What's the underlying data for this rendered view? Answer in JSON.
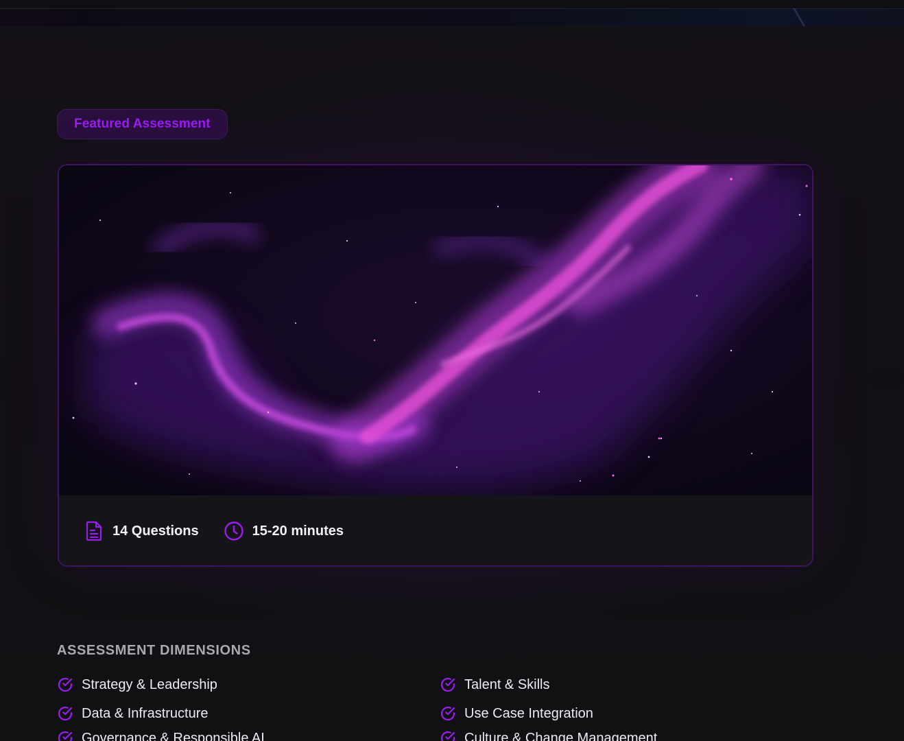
{
  "badge": {
    "label": "Featured Assessment"
  },
  "card": {
    "image_alt": "purple nebula",
    "stats": [
      {
        "icon": "document-icon",
        "label": "14 Questions"
      },
      {
        "icon": "clock-icon",
        "label": "15-20 minutes"
      }
    ]
  },
  "dimensions": {
    "title": "ASSESSMENT DIMENSIONS",
    "items": [
      {
        "label": "Strategy & Leadership"
      },
      {
        "label": "Talent & Skills"
      },
      {
        "label": "Data & Infrastructure"
      },
      {
        "label": "Use Case Integration"
      },
      {
        "label": "Governance & Responsible AI"
      },
      {
        "label": "Culture & Change Management"
      }
    ]
  },
  "colors": {
    "accent": "#9a1cf0",
    "badge_bg": "#2a0f3f",
    "card_border": "#3d1460",
    "background": "#111114"
  }
}
